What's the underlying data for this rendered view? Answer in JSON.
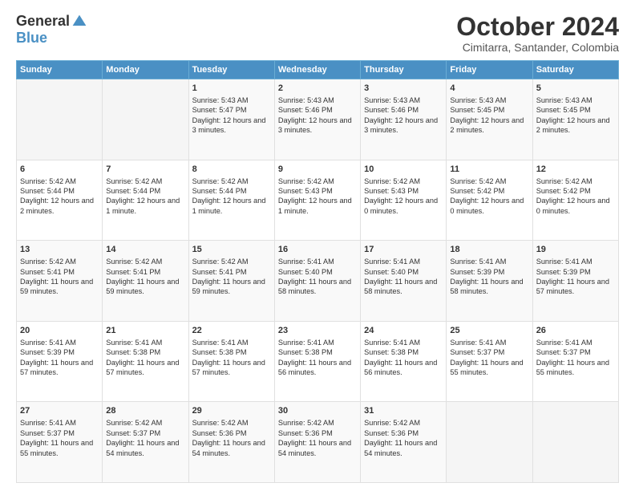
{
  "logo": {
    "general": "General",
    "blue": "Blue"
  },
  "header": {
    "title": "October 2024",
    "location": "Cimitarra, Santander, Colombia"
  },
  "days_of_week": [
    "Sunday",
    "Monday",
    "Tuesday",
    "Wednesday",
    "Thursday",
    "Friday",
    "Saturday"
  ],
  "weeks": [
    [
      {
        "day": "",
        "sunrise": "",
        "sunset": "",
        "daylight": ""
      },
      {
        "day": "",
        "sunrise": "",
        "sunset": "",
        "daylight": ""
      },
      {
        "day": "1",
        "sunrise": "Sunrise: 5:43 AM",
        "sunset": "Sunset: 5:47 PM",
        "daylight": "Daylight: 12 hours and 3 minutes."
      },
      {
        "day": "2",
        "sunrise": "Sunrise: 5:43 AM",
        "sunset": "Sunset: 5:46 PM",
        "daylight": "Daylight: 12 hours and 3 minutes."
      },
      {
        "day": "3",
        "sunrise": "Sunrise: 5:43 AM",
        "sunset": "Sunset: 5:46 PM",
        "daylight": "Daylight: 12 hours and 3 minutes."
      },
      {
        "day": "4",
        "sunrise": "Sunrise: 5:43 AM",
        "sunset": "Sunset: 5:45 PM",
        "daylight": "Daylight: 12 hours and 2 minutes."
      },
      {
        "day": "5",
        "sunrise": "Sunrise: 5:43 AM",
        "sunset": "Sunset: 5:45 PM",
        "daylight": "Daylight: 12 hours and 2 minutes."
      }
    ],
    [
      {
        "day": "6",
        "sunrise": "Sunrise: 5:42 AM",
        "sunset": "Sunset: 5:44 PM",
        "daylight": "Daylight: 12 hours and 2 minutes."
      },
      {
        "day": "7",
        "sunrise": "Sunrise: 5:42 AM",
        "sunset": "Sunset: 5:44 PM",
        "daylight": "Daylight: 12 hours and 1 minute."
      },
      {
        "day": "8",
        "sunrise": "Sunrise: 5:42 AM",
        "sunset": "Sunset: 5:44 PM",
        "daylight": "Daylight: 12 hours and 1 minute."
      },
      {
        "day": "9",
        "sunrise": "Sunrise: 5:42 AM",
        "sunset": "Sunset: 5:43 PM",
        "daylight": "Daylight: 12 hours and 1 minute."
      },
      {
        "day": "10",
        "sunrise": "Sunrise: 5:42 AM",
        "sunset": "Sunset: 5:43 PM",
        "daylight": "Daylight: 12 hours and 0 minutes."
      },
      {
        "day": "11",
        "sunrise": "Sunrise: 5:42 AM",
        "sunset": "Sunset: 5:42 PM",
        "daylight": "Daylight: 12 hours and 0 minutes."
      },
      {
        "day": "12",
        "sunrise": "Sunrise: 5:42 AM",
        "sunset": "Sunset: 5:42 PM",
        "daylight": "Daylight: 12 hours and 0 minutes."
      }
    ],
    [
      {
        "day": "13",
        "sunrise": "Sunrise: 5:42 AM",
        "sunset": "Sunset: 5:41 PM",
        "daylight": "Daylight: 11 hours and 59 minutes."
      },
      {
        "day": "14",
        "sunrise": "Sunrise: 5:42 AM",
        "sunset": "Sunset: 5:41 PM",
        "daylight": "Daylight: 11 hours and 59 minutes."
      },
      {
        "day": "15",
        "sunrise": "Sunrise: 5:42 AM",
        "sunset": "Sunset: 5:41 PM",
        "daylight": "Daylight: 11 hours and 59 minutes."
      },
      {
        "day": "16",
        "sunrise": "Sunrise: 5:41 AM",
        "sunset": "Sunset: 5:40 PM",
        "daylight": "Daylight: 11 hours and 58 minutes."
      },
      {
        "day": "17",
        "sunrise": "Sunrise: 5:41 AM",
        "sunset": "Sunset: 5:40 PM",
        "daylight": "Daylight: 11 hours and 58 minutes."
      },
      {
        "day": "18",
        "sunrise": "Sunrise: 5:41 AM",
        "sunset": "Sunset: 5:39 PM",
        "daylight": "Daylight: 11 hours and 58 minutes."
      },
      {
        "day": "19",
        "sunrise": "Sunrise: 5:41 AM",
        "sunset": "Sunset: 5:39 PM",
        "daylight": "Daylight: 11 hours and 57 minutes."
      }
    ],
    [
      {
        "day": "20",
        "sunrise": "Sunrise: 5:41 AM",
        "sunset": "Sunset: 5:39 PM",
        "daylight": "Daylight: 11 hours and 57 minutes."
      },
      {
        "day": "21",
        "sunrise": "Sunrise: 5:41 AM",
        "sunset": "Sunset: 5:38 PM",
        "daylight": "Daylight: 11 hours and 57 minutes."
      },
      {
        "day": "22",
        "sunrise": "Sunrise: 5:41 AM",
        "sunset": "Sunset: 5:38 PM",
        "daylight": "Daylight: 11 hours and 57 minutes."
      },
      {
        "day": "23",
        "sunrise": "Sunrise: 5:41 AM",
        "sunset": "Sunset: 5:38 PM",
        "daylight": "Daylight: 11 hours and 56 minutes."
      },
      {
        "day": "24",
        "sunrise": "Sunrise: 5:41 AM",
        "sunset": "Sunset: 5:38 PM",
        "daylight": "Daylight: 11 hours and 56 minutes."
      },
      {
        "day": "25",
        "sunrise": "Sunrise: 5:41 AM",
        "sunset": "Sunset: 5:37 PM",
        "daylight": "Daylight: 11 hours and 55 minutes."
      },
      {
        "day": "26",
        "sunrise": "Sunrise: 5:41 AM",
        "sunset": "Sunset: 5:37 PM",
        "daylight": "Daylight: 11 hours and 55 minutes."
      }
    ],
    [
      {
        "day": "27",
        "sunrise": "Sunrise: 5:41 AM",
        "sunset": "Sunset: 5:37 PM",
        "daylight": "Daylight: 11 hours and 55 minutes."
      },
      {
        "day": "28",
        "sunrise": "Sunrise: 5:42 AM",
        "sunset": "Sunset: 5:37 PM",
        "daylight": "Daylight: 11 hours and 54 minutes."
      },
      {
        "day": "29",
        "sunrise": "Sunrise: 5:42 AM",
        "sunset": "Sunset: 5:36 PM",
        "daylight": "Daylight: 11 hours and 54 minutes."
      },
      {
        "day": "30",
        "sunrise": "Sunrise: 5:42 AM",
        "sunset": "Sunset: 5:36 PM",
        "daylight": "Daylight: 11 hours and 54 minutes."
      },
      {
        "day": "31",
        "sunrise": "Sunrise: 5:42 AM",
        "sunset": "Sunset: 5:36 PM",
        "daylight": "Daylight: 11 hours and 54 minutes."
      },
      {
        "day": "",
        "sunrise": "",
        "sunset": "",
        "daylight": ""
      },
      {
        "day": "",
        "sunrise": "",
        "sunset": "",
        "daylight": ""
      }
    ]
  ]
}
